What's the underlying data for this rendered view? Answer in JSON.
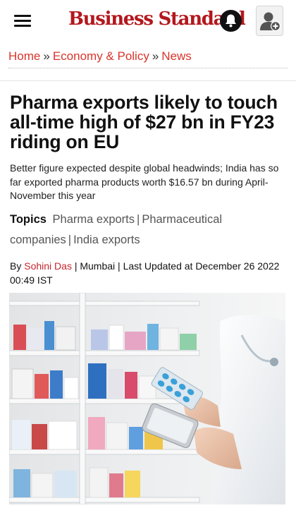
{
  "header": {
    "logo_text": "Business Standard",
    "icons": {
      "menu": "hamburger-menu-icon",
      "notifications": "bell-icon",
      "account": "add-user-icon"
    },
    "brand_color": "#b3171d"
  },
  "breadcrumb": {
    "items": [
      "Home",
      "Economy & Policy",
      "News"
    ],
    "separator": "»",
    "link_color": "#d9342b"
  },
  "article": {
    "title": "Pharma exports likely to touch all-time high of $27 bn in FY23 riding on EU",
    "summary": "Better figure expected despite global headwinds; India has so far exported pharma products worth $16.57 bn during April-November this year",
    "topics_label": "Topics",
    "topics": [
      "Pharma exports",
      "Pharmaceutical companies",
      "India exports"
    ],
    "byline_prefix": "By",
    "author": "Sohini Das",
    "location": "Mumbai",
    "updated": "Last Updated at December 26 2022 00:49 IST",
    "hero_image": "pharmacist-holding-medicine-and-phone-photo"
  }
}
